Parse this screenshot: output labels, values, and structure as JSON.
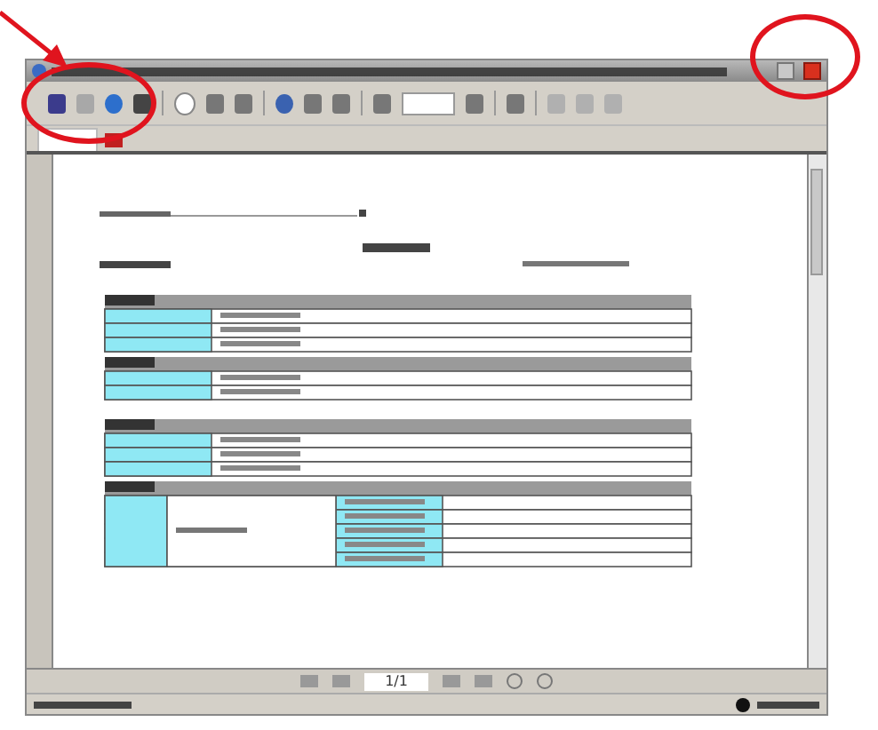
{
  "viewer": {
    "page_indicator": "1/1"
  },
  "annotations": [
    {
      "kind": "arrow"
    },
    {
      "kind": "ellipse"
    },
    {
      "kind": "ellipse"
    }
  ]
}
